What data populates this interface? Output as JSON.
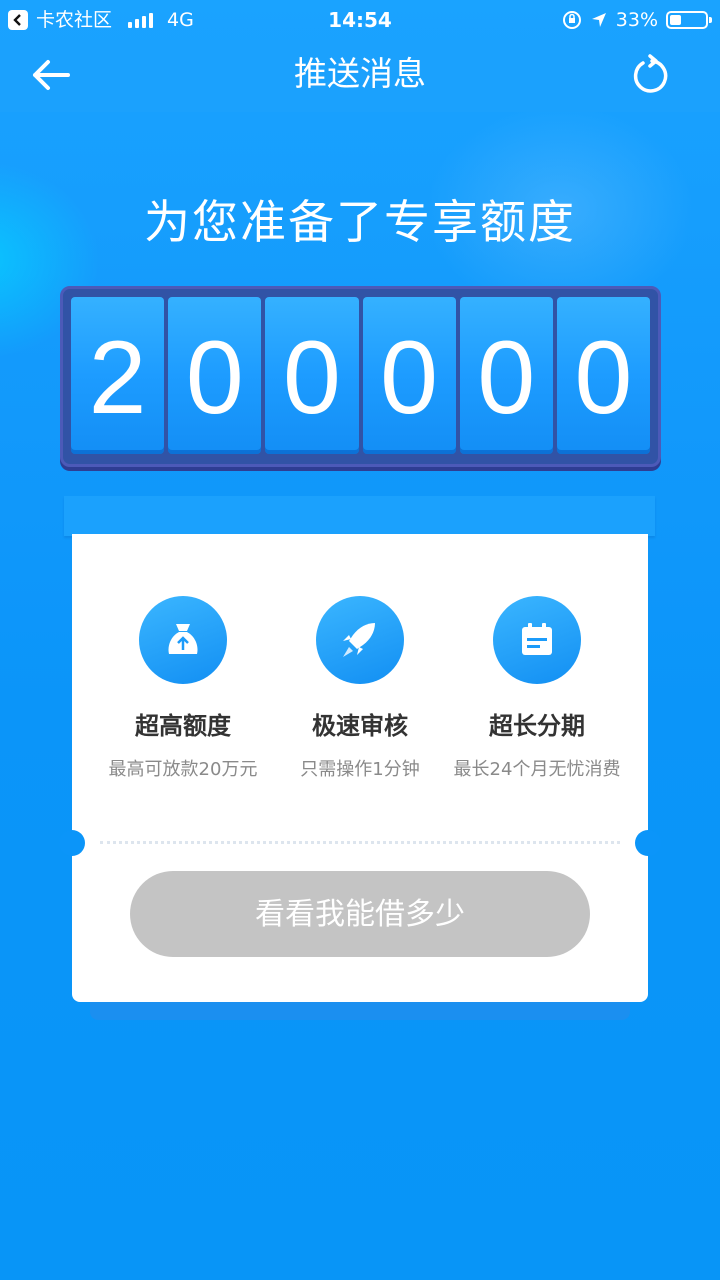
{
  "status_bar": {
    "carrier_app": "卡农社区",
    "network": "4G",
    "time": "14:54",
    "battery": "33%"
  },
  "nav": {
    "title": "推送消息",
    "back_icon": "back-arrow-icon",
    "refresh_icon": "refresh-icon"
  },
  "headline": "为您准备了专享额度",
  "counter": {
    "digits": [
      "2",
      "0",
      "0",
      "0",
      "0",
      "0"
    ]
  },
  "features": [
    {
      "icon": "money-bag-icon",
      "title": "超高额度",
      "subtitle": "最高可放款20万元"
    },
    {
      "icon": "rocket-icon",
      "title": "极速审核",
      "subtitle": "只需操作1分钟"
    },
    {
      "icon": "calendar-icon",
      "title": "超长分期",
      "subtitle": "最长24个月无忧消费"
    }
  ],
  "cta": {
    "label": "看看我能借多少"
  },
  "colors": {
    "primary": "#1ba1fd",
    "counter_frame": "#3153a6",
    "button_disabled": "#c4c4c4"
  }
}
